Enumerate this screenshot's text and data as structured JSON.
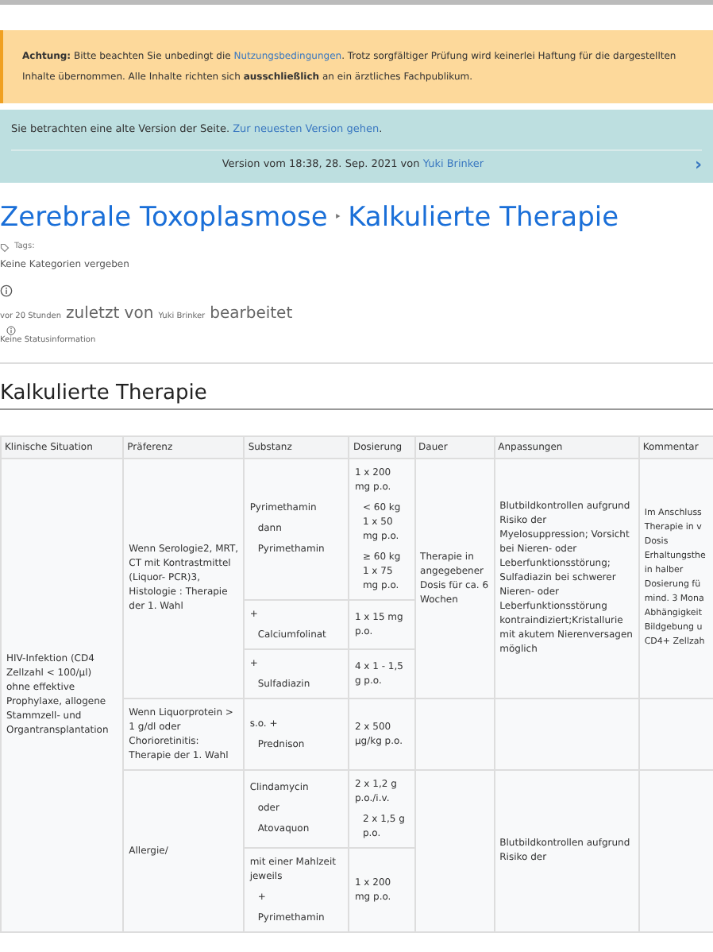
{
  "notice": {
    "label": "Achtung:",
    "text_before": "Bitte beachten Sie unbedingt die",
    "link": "Nutzungsbedingungen",
    "text_after": ". Trotz sorgfältiger Prüfung wird keinerlei Haftung für die dargestellten Inhalte übernommen. Alle Inhalte richten sich **ausschließlich** an ein ärztliches Fachpublikum."
  },
  "version_banner": {
    "text": "Sie betrachten eine alte Version der Seite.",
    "link": "Zur neuesten Version gehen",
    "suffix": ".",
    "version_text": "Version vom 18:38, 28. Sep. 2021 von",
    "author": "Yuki Brinker",
    "next": "›"
  },
  "title": {
    "parts": [
      "Zerebrale Toxoplasmose",
      "Kalkulierte Therapie"
    ],
    "separator": "‣"
  },
  "tags": {
    "label": "Tags:",
    "categories": "Keine Kategorien vergeben"
  },
  "edited": {
    "time": "vor 20 Stunden",
    "label": "zuletzt von",
    "author": "Yuki Brinker",
    "suffix": "bearbeitet"
  },
  "status": "Keine Statusinformation",
  "section": {
    "heading": "Kalkulierte Therapie",
    "table": {
      "columns": [
        "Klinische Situation",
        "Präferenz",
        "Substanz",
        "Dosierung",
        "Dauer",
        "Anpassungen",
        "Kommentar"
      ],
      "rows": [
        {
          "cells": [
            {
              "lines": [
                "HIV-Infektion (CD4 Zellzahl < 100/µl) ohne effektive Prophylaxe, allogene Stammzell- und Organtransplantation"
              ],
              "rowspan": 6
            },
            {
              "lines": [
                "Wenn  Serologie2, MRT, CT mit Kontrastmittel (Liquor- PCR)3, Histologie : Therapie der 1. Wahl"
              ],
              "rowspan": 3
            },
            {
              "lines": [
                "Pyrimethamin",
                "dann",
                "Pyrimethamin"
              ]
            },
            {
              "lines": [
                "1 x 200 mg p.o.",
                "<   60 kg 1 x 50 mg p.o.",
                "≥   60 kg 1 x 75 mg p.o."
              ]
            },
            {
              "lines": [
                "Therapie in angegebener Dosis für ca. 6 Wochen"
              ],
              "rowspan": 3
            },
            {
              "lines": [
                "Blutbildkontrollen aufgrund Risiko der Myelosuppression; Vorsicht bei Nieren- oder Leberfunktionsstörung; Sulfadiazin bei schwerer Nieren- oder Leberfunktionsstörung kontraindiziert;Kristallurie mit akutem Nierenversagen möglich"
              ],
              "rowspan": 3
            },
            {
              "lines": [
                "Im Anschluss",
                "Therapie in v",
                "Dosis",
                "Erhaltungsthe",
                "in halber",
                "Dosierung fü",
                "mind. 3 Mona",
                "Abhängigkeit",
                "Bildgebung u",
                "CD4+ Zellzah"
              ],
              "rowspan": 3
            }
          ]
        },
        {
          "cells": [
            {
              "lines": [
                "+",
                "Calciumfolinat"
              ]
            },
            {
              "lines": [
                "1 x 15 mg p.o."
              ]
            }
          ]
        },
        {
          "cells": [
            {
              "lines": [
                "+",
                "Sulfadiazin"
              ]
            },
            {
              "lines": [
                "4 x 1 - 1,5 g p.o."
              ]
            }
          ]
        },
        {
          "cells": [
            {
              "lines": [
                "Wenn  Liquorprotein > 1 g/dl oder Chorioretinitis: Therapie der 1. Wahl"
              ]
            },
            {
              "lines": [
                "s.o. +",
                "Prednison"
              ]
            },
            {
              "lines": [
                "2 x 500 µg/kg p.o."
              ]
            },
            {},
            {},
            {}
          ]
        },
        {
          "cells": [
            {
              "lines": [
                "Allergie/"
              ],
              "rowspan": 2
            },
            {
              "lines": [
                "Clindamycin",
                "oder",
                "Atovaquon"
              ]
            },
            {
              "lines": [
                "2 x 1,2 g p.o./i.v.",
                "2    x 1,5   g p.o."
              ]
            },
            {
              "rowspan": 2
            },
            {
              "lines": [
                "Blutbildkontrollen aufgrund Risiko der"
              ],
              "rowspan": 2
            },
            {
              "rowspan": 2
            }
          ]
        },
        {
          "cells": [
            {
              "lines": [
                "mit einer Mahlzeit jeweils",
                "+",
                "Pyrimethamin"
              ]
            },
            {
              "lines": [
                "1 x 200 mg p.o."
              ]
            }
          ]
        }
      ]
    }
  }
}
